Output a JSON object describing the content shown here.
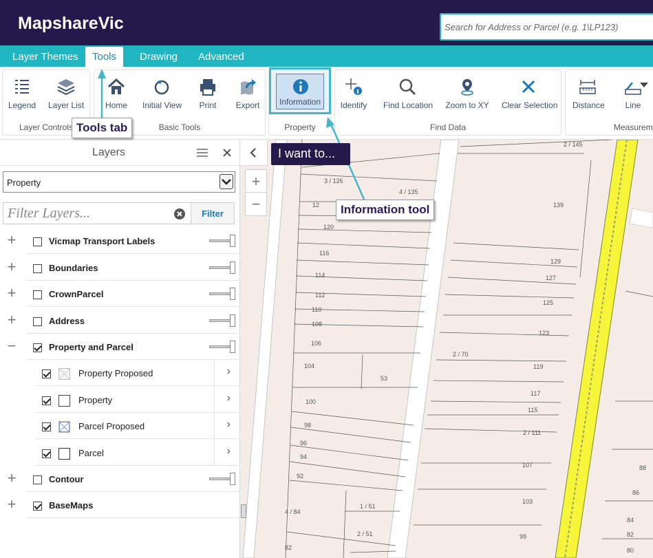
{
  "app": {
    "title": "MapshareVic",
    "search_placeholder": "Search for Address or Parcel (e.g. 1\\LP123)"
  },
  "tabs": [
    {
      "label": "Layer Themes",
      "active": false
    },
    {
      "label": "Tools",
      "active": true
    },
    {
      "label": "Drawing",
      "active": false
    },
    {
      "label": "Advanced",
      "active": false
    }
  ],
  "ribbon": {
    "groups": [
      {
        "label": "Layer Controls",
        "tools": [
          {
            "label": "Legend",
            "icon": "legend-icon"
          },
          {
            "label": "Layer List",
            "icon": "layers-icon"
          }
        ]
      },
      {
        "label": "Basic Tools",
        "tools": [
          {
            "label": "Home",
            "icon": "home-icon"
          },
          {
            "label": "Initial View",
            "icon": "refresh-icon"
          },
          {
            "label": "Print",
            "icon": "print-icon"
          },
          {
            "label": "Export",
            "icon": "export-icon"
          }
        ]
      },
      {
        "label": "Property",
        "tools": [
          {
            "label": "Information",
            "icon": "info-icon"
          }
        ]
      },
      {
        "label": "Find Data",
        "tools": [
          {
            "label": "Identify",
            "icon": "identify-icon"
          },
          {
            "label": "Find Location",
            "icon": "magnifier-icon"
          },
          {
            "label": "Zoom to XY",
            "icon": "pin-icon"
          },
          {
            "label": "Clear Selection",
            "icon": "close-icon"
          }
        ]
      },
      {
        "label": "Measureme",
        "tools": [
          {
            "label": "Distance",
            "icon": "ruler-icon"
          },
          {
            "label": "Line",
            "icon": "line-measure-icon"
          }
        ]
      }
    ]
  },
  "callouts": {
    "tools_tab": "Tools tab",
    "info_tool": "Information tool",
    "i_want_to": "I want to..."
  },
  "layers_panel": {
    "title": "Layers",
    "theme_select": "Property",
    "filter_placeholder": "Filter Layers...",
    "filter_button": "Filter",
    "layers": [
      {
        "name": "Vicmap Transport Labels",
        "checked": false,
        "expander": "+"
      },
      {
        "name": "Boundaries",
        "checked": false,
        "expander": "+"
      },
      {
        "name": "CrownParcel",
        "checked": false,
        "expander": "+"
      },
      {
        "name": "Address",
        "checked": false,
        "expander": "+"
      },
      {
        "name": "Property and Parcel",
        "checked": true,
        "expander": "−"
      },
      {
        "name": "Contour",
        "checked": false,
        "expander": "+"
      },
      {
        "name": "BaseMaps",
        "checked": true,
        "expander": "+"
      }
    ],
    "sublayers": [
      {
        "name": "Property Proposed",
        "checked": true,
        "symbol": "proposed"
      },
      {
        "name": "Property",
        "checked": true,
        "symbol": "outline"
      },
      {
        "name": "Parcel Proposed",
        "checked": true,
        "symbol": "cross"
      },
      {
        "name": "Parcel",
        "checked": true,
        "symbol": "blue"
      }
    ]
  },
  "map": {
    "labels": [
      "2 / 145",
      "3 / 126",
      "4 / 135",
      "139",
      "12",
      "120",
      "116",
      "129",
      "114",
      "127",
      "112",
      "125",
      "110",
      "108",
      "123",
      "106",
      "2 / 70",
      "119",
      "104",
      "53",
      "117",
      "100",
      "115",
      "98",
      "2 / 111",
      "96",
      "94",
      "107",
      "92",
      "88",
      "86",
      "103",
      "4 / 84",
      "1 / 51",
      "84",
      "2 / 51",
      "82",
      "99",
      "82",
      "80"
    ]
  },
  "colors": {
    "header_bg": "#24194b",
    "tab_bar": "#1fb6c2",
    "callout_line": "#45b6c9",
    "road_yellow": "#f7f53a",
    "map_bg": "#f5ece8"
  }
}
